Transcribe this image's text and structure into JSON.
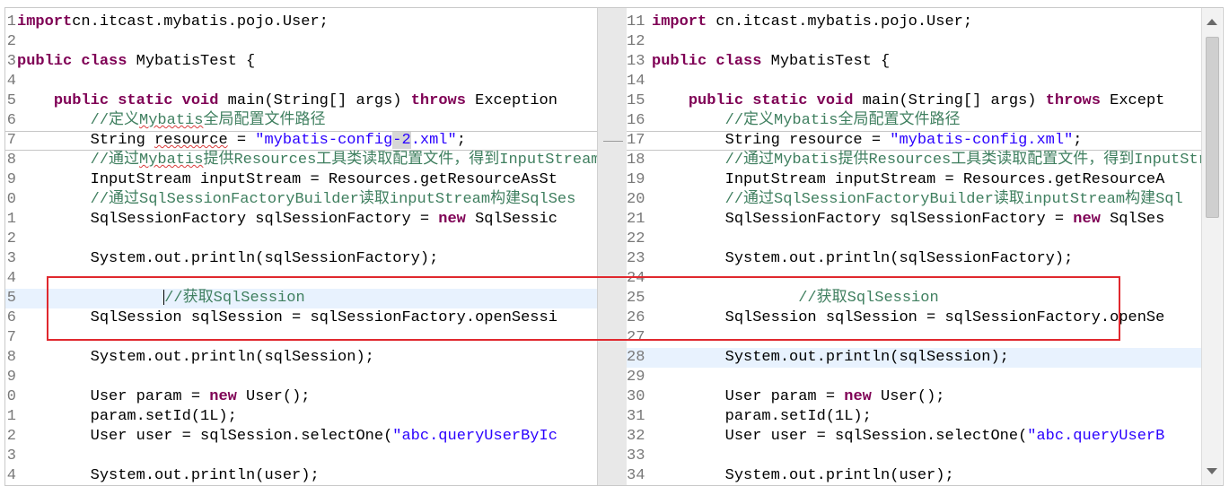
{
  "left": {
    "lines": [
      {
        "n": "1",
        "parts": [
          [
            "kw",
            "import"
          ],
          [
            "",
            "cn.itcast.mybatis.pojo.User;"
          ]
        ]
      },
      {
        "n": "2",
        "parts": []
      },
      {
        "n": "3",
        "parts": [
          [
            "kw",
            "public"
          ],
          [
            "",
            " "
          ],
          [
            "kw",
            "class"
          ],
          [
            "",
            " MybatisTest {"
          ]
        ]
      },
      {
        "n": "4",
        "parts": []
      },
      {
        "n": "5",
        "parts": [
          [
            "",
            "    "
          ],
          [
            "kw",
            "public"
          ],
          [
            "",
            " "
          ],
          [
            "kw",
            "static"
          ],
          [
            "",
            " "
          ],
          [
            "kw",
            "void"
          ],
          [
            "",
            " main(String[] args) "
          ],
          [
            "kw",
            "throws"
          ],
          [
            "",
            " Exception"
          ]
        ]
      },
      {
        "n": "6",
        "parts": [
          [
            "",
            "        "
          ],
          [
            "cm",
            "//定义"
          ],
          [
            "cmsq",
            "Mybatis"
          ],
          [
            "cm",
            "全局配置文件路径"
          ]
        ]
      },
      {
        "n": "7",
        "changed": true,
        "parts": [
          [
            "",
            "        String "
          ],
          [
            "sq",
            "resource"
          ],
          [
            "",
            " = "
          ],
          [
            "str",
            "\"mybatis-config"
          ],
          [
            "diff",
            "-2"
          ],
          [
            "str",
            ".xml\""
          ],
          [
            "",
            ";"
          ]
        ]
      },
      {
        "n": "8",
        "parts": [
          [
            "",
            "        "
          ],
          [
            "cm",
            "//通过"
          ],
          [
            "cmsq",
            "Mybatis"
          ],
          [
            "cm",
            "提供Resources工具类读取配置文件，得到InputStream"
          ]
        ]
      },
      {
        "n": "9",
        "parts": [
          [
            "",
            "        InputStream inputStream = Resources.getResourceAsSt"
          ]
        ]
      },
      {
        "n": "0",
        "parts": [
          [
            "",
            "        "
          ],
          [
            "cm",
            "//通过SqlSessionFactoryBuilder读取inputStream构建SqlSes"
          ]
        ]
      },
      {
        "n": "1",
        "parts": [
          [
            "",
            "        SqlSessionFactory sqlSessionFactory = "
          ],
          [
            "kw",
            "new"
          ],
          [
            "",
            " SqlSessic"
          ]
        ]
      },
      {
        "n": "2",
        "parts": []
      },
      {
        "n": "3",
        "parts": [
          [
            "",
            "        System.out.println(sqlSessionFactory);"
          ]
        ]
      },
      {
        "n": "4",
        "parts": []
      },
      {
        "n": "5",
        "hl": true,
        "parts": [
          [
            "",
            "                "
          ],
          [
            "cursor",
            ""
          ],
          [
            "cm",
            "//获取SqlSession"
          ]
        ]
      },
      {
        "n": "6",
        "parts": [
          [
            "",
            "        SqlSession sqlSession = sqlSessionFactory.openSessi"
          ]
        ]
      },
      {
        "n": "7",
        "parts": []
      },
      {
        "n": "8",
        "parts": [
          [
            "",
            "        System.out.println(sqlSession);"
          ]
        ]
      },
      {
        "n": "9",
        "parts": []
      },
      {
        "n": "0",
        "parts": [
          [
            "",
            "        User param = "
          ],
          [
            "kw",
            "new"
          ],
          [
            "",
            " User();"
          ]
        ]
      },
      {
        "n": "1",
        "parts": [
          [
            "",
            "        param.setId(1L);"
          ]
        ]
      },
      {
        "n": "2",
        "parts": [
          [
            "",
            "        User user = sqlSession.selectOne("
          ],
          [
            "str",
            "\"abc.queryUserByIc"
          ]
        ]
      },
      {
        "n": "3",
        "parts": []
      },
      {
        "n": "4",
        "parts": [
          [
            "",
            "        System.out.println(user);"
          ]
        ]
      }
    ]
  },
  "right": {
    "lines": [
      {
        "n": "11",
        "parts": [
          [
            "kw",
            "import"
          ],
          [
            "",
            " cn.itcast.mybatis.pojo.User;"
          ]
        ]
      },
      {
        "n": "12",
        "parts": []
      },
      {
        "n": "13",
        "parts": [
          [
            "kw",
            "public"
          ],
          [
            "",
            " "
          ],
          [
            "kw",
            "class"
          ],
          [
            "",
            " MybatisTest {"
          ]
        ]
      },
      {
        "n": "14",
        "parts": []
      },
      {
        "n": "15",
        "parts": [
          [
            "",
            "    "
          ],
          [
            "kw",
            "public"
          ],
          [
            "",
            " "
          ],
          [
            "kw",
            "static"
          ],
          [
            "",
            " "
          ],
          [
            "kw",
            "void"
          ],
          [
            "",
            " main(String[] args) "
          ],
          [
            "kw",
            "throws"
          ],
          [
            "",
            " Except"
          ]
        ]
      },
      {
        "n": "16",
        "parts": [
          [
            "",
            "        "
          ],
          [
            "cm",
            "//定义Mybatis全局配置文件路径"
          ]
        ]
      },
      {
        "n": "17",
        "changed": true,
        "parts": [
          [
            "",
            "        String resource = "
          ],
          [
            "str",
            "\"mybatis-config.xml\""
          ],
          [
            "",
            ";"
          ]
        ]
      },
      {
        "n": "18",
        "parts": [
          [
            "",
            "        "
          ],
          [
            "cm",
            "//通过Mybatis提供Resources工具类读取配置文件，得到InputStr"
          ]
        ]
      },
      {
        "n": "19",
        "parts": [
          [
            "",
            "        InputStream inputStream = Resources.getResourceA"
          ]
        ]
      },
      {
        "n": "20",
        "parts": [
          [
            "",
            "        "
          ],
          [
            "cm",
            "//通过SqlSessionFactoryBuilder读取inputStream构建Sql"
          ]
        ]
      },
      {
        "n": "21",
        "parts": [
          [
            "",
            "        SqlSessionFactory sqlSessionFactory = "
          ],
          [
            "kw",
            "new"
          ],
          [
            "",
            " SqlSes"
          ]
        ]
      },
      {
        "n": "22",
        "parts": []
      },
      {
        "n": "23",
        "parts": [
          [
            "",
            "        System.out.println(sqlSessionFactory);"
          ]
        ]
      },
      {
        "n": "24",
        "parts": []
      },
      {
        "n": "25",
        "parts": [
          [
            "",
            "                "
          ],
          [
            "cm",
            "//获取SqlSession"
          ]
        ]
      },
      {
        "n": "26",
        "parts": [
          [
            "",
            "        SqlSession sqlSession = sqlSessionFactory.openSe"
          ]
        ]
      },
      {
        "n": "27",
        "parts": []
      },
      {
        "n": "28",
        "hl": true,
        "parts": [
          [
            "",
            "        System.out.println(sqlSession);"
          ]
        ]
      },
      {
        "n": "29",
        "parts": []
      },
      {
        "n": "30",
        "parts": [
          [
            "",
            "        User param = "
          ],
          [
            "kw",
            "new"
          ],
          [
            "",
            " User();"
          ]
        ]
      },
      {
        "n": "31",
        "parts": [
          [
            "",
            "        param.setId(1L);"
          ]
        ]
      },
      {
        "n": "32",
        "parts": [
          [
            "",
            "        User user = sqlSession.selectOne("
          ],
          [
            "str",
            "\"abc.queryUserB"
          ]
        ]
      },
      {
        "n": "33",
        "parts": []
      },
      {
        "n": "34",
        "parts": [
          [
            "",
            "        System.out.println(user);"
          ]
        ]
      }
    ]
  },
  "colors": {
    "keyword": "#7f0055",
    "string": "#2a00ff",
    "comment": "#3f7f5f",
    "highlight_box": "#e0282e",
    "current_line": "#e8f2fe"
  }
}
